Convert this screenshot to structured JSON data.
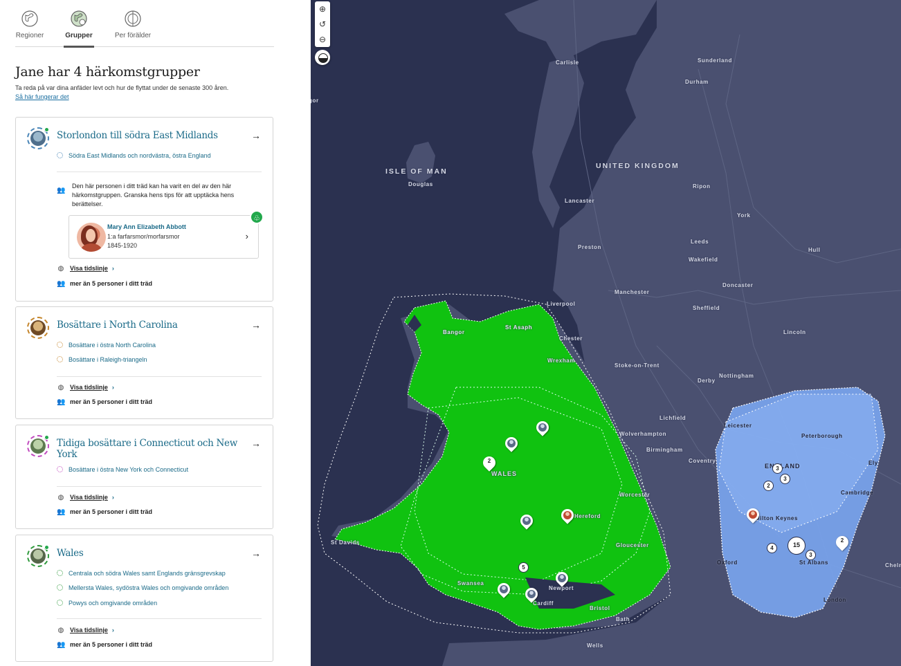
{
  "tabs": [
    {
      "label": "Regioner",
      "icon": "globe-icon"
    },
    {
      "label": "Grupper",
      "icon": "groups-globe-icon"
    },
    {
      "label": "Per förälder",
      "icon": "parent-globe-icon"
    }
  ],
  "heading": "Jane har 4 härkomstgrupper",
  "subtext": "Ta reda på var dina anfäder levt och hur de flyttat under de senaste 300 åren.",
  "how_link": "Så här fungerar det",
  "common": {
    "timeline_label": "Visa tidslinje",
    "more_than": "mer än 5 personer i ditt träd",
    "arrow": "→",
    "chevron": "›"
  },
  "cards": [
    {
      "title": "Storlondon till södra East Midlands",
      "color": "#4a86b8",
      "subs": [
        "Södra East Midlands och nordvästra, östra England"
      ],
      "note": "Den här personen i ditt träd kan ha varit en del av den här härkomstgruppen. Granska hens tips för att upptäcka hens berättelser.",
      "person": {
        "name": "Mary Ann Elizabeth Abbott",
        "relation": "1:a farfarsmor/morfarsmor",
        "years": "1845-1920"
      }
    },
    {
      "title": "Bosättare i North Carolina",
      "color": "#c5862c",
      "subs": [
        "Bosättare i östra North Carolina",
        "Bosättare i Raleigh-triangeln"
      ]
    },
    {
      "title": "Tidiga bosättare i Connecticut och New York",
      "color": "#c14bbf",
      "subs": [
        "Bosättare i östra New York och Connecticut"
      ]
    },
    {
      "title": "Wales",
      "color": "#2f9a3c",
      "subs": [
        "Centrala och södra Wales samt Englands gränsgrevskap",
        "Mellersta Wales, sydöstra Wales och omgivande områden",
        "Powys och omgivande områden"
      ]
    }
  ],
  "map": {
    "controls": [
      "zoom-in-icon",
      "reset-icon",
      "zoom-out-icon",
      "contrast-icon"
    ],
    "region_labels": {
      "iom": "ISLE OF MAN",
      "uk": "UNITED KINGDOM",
      "wales": "WALES",
      "england": "ENGLAND"
    },
    "places": {
      "carlisle": "Carlisle",
      "sunderland": "Sunderland",
      "durham": "Durham",
      "douglas": "Douglas",
      "ripon": "Ripon",
      "lancaster": "Lancaster",
      "york": "York",
      "preston": "Preston",
      "leeds": "Leeds",
      "hull": "Hull",
      "wakefield": "Wakefield",
      "doncaster": "Doncaster",
      "manchester": "Manchester",
      "liverpool": "Liverpool",
      "sheffield": "Sheffield",
      "st_asaph": "St Asaph",
      "chester": "Chester",
      "bangor": "Bangor",
      "lincoln": "Lincoln",
      "wrexham": "Wrexham",
      "stoke": "Stoke-on-Trent",
      "nottingham": "Nottingham",
      "derby": "Derby",
      "lichfield": "Lichfield",
      "leicester": "Leicester",
      "peterborough": "Peterborough",
      "wolverhampton": "Wolverhampton",
      "birmingham": "Birmingham",
      "coventry": "Coventry",
      "ely": "Ely",
      "cambridge": "Cambridge",
      "worcester": "Worcester",
      "hereford": "Hereford",
      "milton_keynes": "Milton Keynes",
      "st_davids": "St Davids",
      "gloucester": "Gloucester",
      "oxford": "Oxford",
      "st_albans": "St Albans",
      "chelmsford": "Chelmsf",
      "swansea": "Swansea",
      "newport": "Newport",
      "cardiff": "Cardiff",
      "london": "London",
      "bristol": "Bristol",
      "bath": "Bath",
      "wells": "Wells",
      "edge_left": "gor"
    },
    "clusters": {
      "c2w": "2",
      "c5": "5",
      "c3a": "3",
      "c3b": "3",
      "c2e": "2",
      "c4": "4",
      "c15": "15",
      "c3c": "3",
      "c2f": "2"
    }
  }
}
